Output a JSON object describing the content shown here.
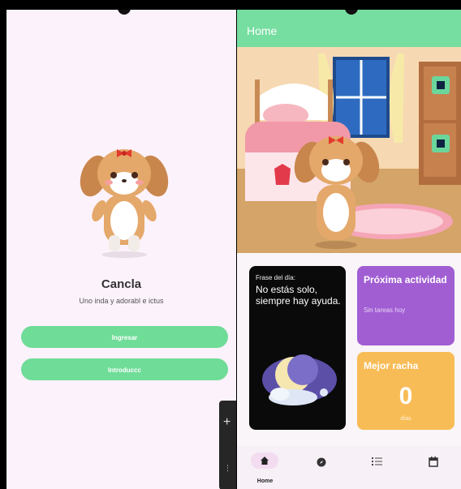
{
  "welcome": {
    "app_name": "Cancla",
    "tagline": "Uno inda y adorabl e ictus",
    "primary_button": "Ingresar",
    "secondary_button": "Introduccc"
  },
  "home": {
    "appbar_title": "Home",
    "quote_card": {
      "label": "Frase del día:",
      "text": "No estás solo, siempre hay ayuda."
    },
    "activity_card": {
      "title": "Próxima actividad",
      "subtitle": "Sin tareas hoy"
    },
    "streak_card": {
      "title": "Mejor racha",
      "value": "0",
      "unit": "días"
    },
    "bottom_nav": [
      {
        "label": "Home",
        "icon": "home-icon",
        "active": true
      },
      {
        "label": "",
        "icon": "compass-icon",
        "active": false
      },
      {
        "label": "",
        "icon": "list-icon",
        "active": false
      },
      {
        "label": "",
        "icon": "calendar-icon",
        "active": false
      }
    ]
  },
  "colors": {
    "accent_green": "#76dea0",
    "button_green": "#6fdc98",
    "activity_purple": "#a15ed3",
    "streak_orange": "#f8bc56",
    "quote_black": "#0a0a0a",
    "welcome_background": "#fcf2fb"
  }
}
